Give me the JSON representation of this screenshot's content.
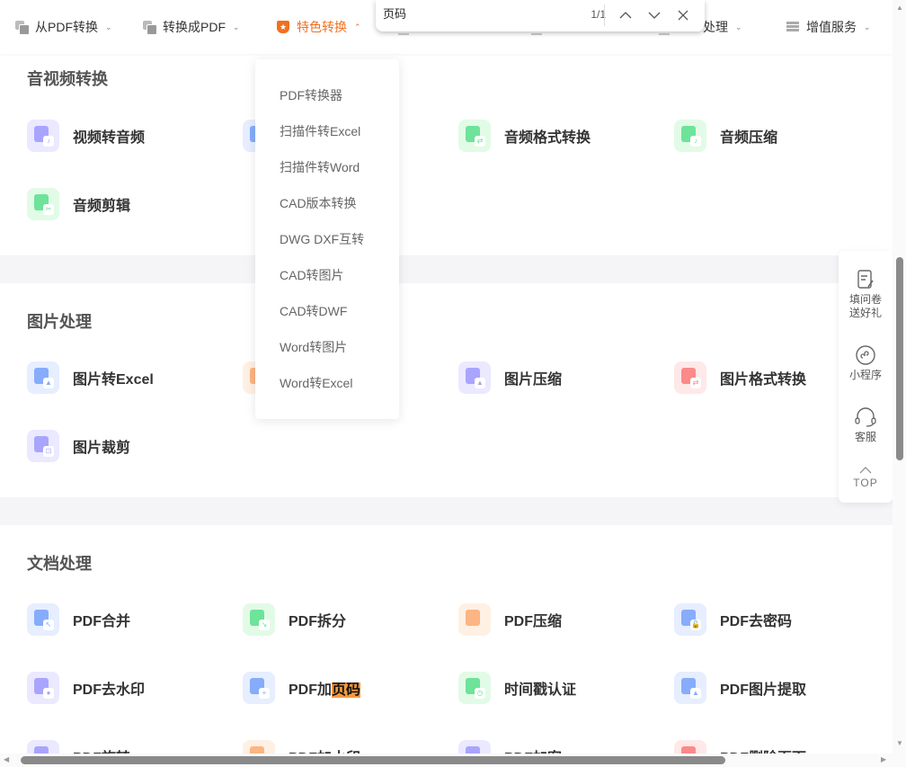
{
  "nav": {
    "items": [
      {
        "label": "从PDF转换",
        "icon": "pdf-from-icon"
      },
      {
        "label": "转换成PDF",
        "icon": "pdf-to-icon"
      },
      {
        "label": "特色转换",
        "icon": "star-shield-icon",
        "active": true
      },
      {
        "label": "处理",
        "icon": "doc-icon"
      },
      {
        "label": "增值服务",
        "icon": "list-icon"
      }
    ]
  },
  "find": {
    "query": "页码",
    "count": "1/1",
    "prev_icon": "chevron-up-icon",
    "next_icon": "chevron-down-icon",
    "close_icon": "close-icon"
  },
  "dropdown": {
    "items": [
      "PDF转换器",
      "扫描件转Excel",
      "扫描件转Word",
      "CAD版本转换",
      "DWG DXF互转",
      "CAD转图片",
      "CAD转DWF",
      "Word转图片",
      "Word转Excel"
    ]
  },
  "sections": [
    {
      "title": "音视频转换",
      "tools": [
        {
          "label": "视频转音频",
          "color": "purple",
          "badge": "♪"
        },
        {
          "label": "",
          "color": "blue",
          "badge": ""
        },
        {
          "label": "音频格式转换",
          "color": "green",
          "badge": "⇄"
        },
        {
          "label": "音频压缩",
          "color": "green",
          "badge": "♪"
        },
        {
          "label": "音频剪辑",
          "color": "green",
          "badge": "✂"
        }
      ]
    },
    {
      "title": "图片处理",
      "tools": [
        {
          "label": "图片转Excel",
          "color": "blue",
          "badge": "▲"
        },
        {
          "label": "",
          "color": "orange",
          "badge": ""
        },
        {
          "label": "图片压缩",
          "color": "purple",
          "badge": "▲"
        },
        {
          "label": "图片格式转换",
          "color": "red",
          "badge": "⇄"
        },
        {
          "label": "图片裁剪",
          "color": "purple",
          "badge": "⊡"
        }
      ]
    },
    {
      "title": "文档处理",
      "tools": [
        {
          "label": "PDF合并",
          "color": "blue",
          "badge": "↖"
        },
        {
          "label": "PDF拆分",
          "color": "green",
          "badge": "↘"
        },
        {
          "label": "PDF压缩",
          "color": "orange",
          "badge": ""
        },
        {
          "label": "PDF去密码",
          "color": "blue",
          "badge": "🔓"
        },
        {
          "label": "PDF去水印",
          "color": "purple",
          "badge": "●"
        },
        {
          "label_pre": "PDF加",
          "label_hl": "页码",
          "color": "blue",
          "badge": "+"
        },
        {
          "label": "时间戳认证",
          "color": "green",
          "badge": "◷"
        },
        {
          "label": "PDF图片提取",
          "color": "blue",
          "badge": "▲"
        },
        {
          "label": "PDF旋转",
          "color": "purple",
          "badge": ""
        },
        {
          "label": "PDF加水印",
          "color": "orange",
          "badge": ""
        },
        {
          "label": "PDF加密",
          "color": "purple",
          "badge": ""
        },
        {
          "label": "PDF删除页面",
          "color": "red",
          "badge": ""
        }
      ]
    }
  ],
  "float": {
    "items": [
      {
        "label": "填问卷\n送好礼",
        "icon": "survey-icon"
      },
      {
        "label": "小程序",
        "icon": "mini-program-icon"
      },
      {
        "label": "客服",
        "icon": "headset-icon"
      },
      {
        "label": "TOP",
        "icon": "back-to-top-icon"
      }
    ]
  }
}
